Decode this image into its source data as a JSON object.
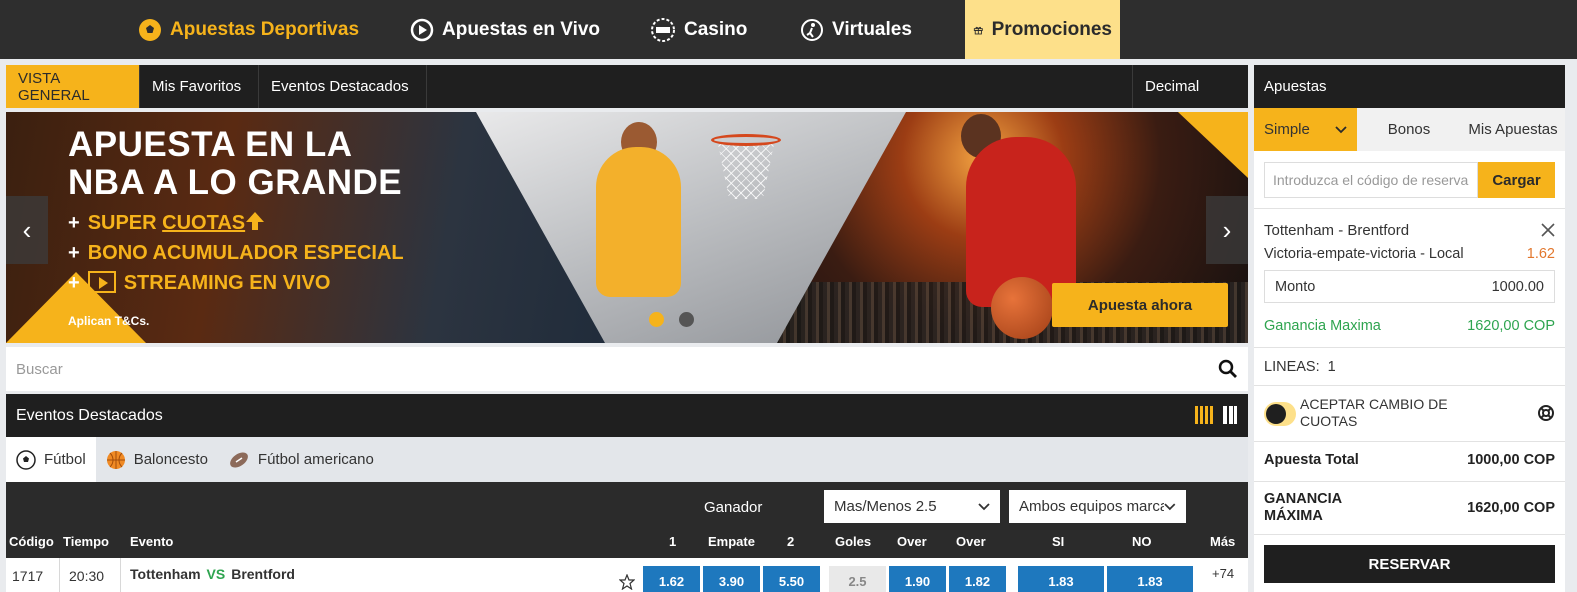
{
  "topnav": {
    "items": [
      {
        "label": "Apuestas Deportivas",
        "icon": "soccer-ball-icon"
      },
      {
        "label": "Apuestas en Vivo",
        "icon": "play-circle-icon"
      },
      {
        "label": "Casino",
        "icon": "casino-chip-icon"
      },
      {
        "label": "Virtuales",
        "icon": "virtual-player-icon"
      },
      {
        "label": "Promociones",
        "icon": "gift-icon"
      }
    ],
    "active_color": "#f6b31b"
  },
  "tabs": {
    "items": [
      "VISTA GENERAL",
      "Mis Favoritos",
      "Eventos Destacados"
    ],
    "odds_format": "Decimal"
  },
  "banner": {
    "headline_1": "APUESTA EN LA",
    "headline_2": "NBA A LO GRANDE",
    "bullet_1a": "SUPER ",
    "bullet_1b": "CUOTAS",
    "bullet_2": "BONO ACUMULADOR ESPECIAL",
    "bullet_3": "STREAMING EN VIVO",
    "plus": "+",
    "terms": "Aplican T&Cs.",
    "cta": "Apuesta ahora",
    "prev": "‹",
    "next": "›"
  },
  "search": {
    "placeholder": "Buscar"
  },
  "featured": {
    "title": "Eventos Destacados"
  },
  "sports": [
    {
      "label": "Fútbol",
      "icon": "soccer-ball-icon"
    },
    {
      "label": "Baloncesto",
      "icon": "basketball-icon"
    },
    {
      "label": "Fútbol americano",
      "icon": "american-football-icon"
    }
  ],
  "market": {
    "label": "Ganador",
    "select_1": "Mas/Menos 2.5",
    "select_2": "Ambos equipos marca"
  },
  "columns": {
    "code": "Código",
    "time": "Tiempo",
    "event": "Evento",
    "one": "1",
    "draw": "Empate",
    "two": "2",
    "goals": "Goles",
    "over1": "Over",
    "over2": "Over",
    "yes": "SI",
    "no": "NO",
    "more": "Más"
  },
  "event": {
    "code": "1717",
    "time": "20:30",
    "home": "Tottenham",
    "vs": "VS",
    "away": "Brentford",
    "odds": [
      "1.62",
      "3.90",
      "5.50"
    ],
    "goals": "2.5",
    "overs": [
      "1.90",
      "1.82"
    ],
    "btts": [
      "1.83",
      "1.83"
    ],
    "more": "+74"
  },
  "slip": {
    "title": "Apuestas",
    "tabs": [
      "Simple",
      "Bonos",
      "Mis Apuestas"
    ],
    "code_placeholder": "Introduzca el código de reserva",
    "load": "Cargar",
    "match": "Tottenham - Brentford",
    "selection": "Victoria-empate-victoria - Local",
    "price": "1.62",
    "amount_label": "Monto",
    "amount_value": "1000.00",
    "maxwin_label": "Ganancia Maxima",
    "maxwin_value": "1620,00 COP",
    "lines_label": "LINEAS:",
    "lines_value": "1",
    "accept_label": "ACEPTAR CAMBIO DE CUOTAS",
    "total_label": "Apuesta Total",
    "total_value": "1000,00 COP",
    "gain_label": "GANANCIA MÁXIMA",
    "gain_value": "1620,00 COP",
    "reserve": "RESERVAR"
  }
}
